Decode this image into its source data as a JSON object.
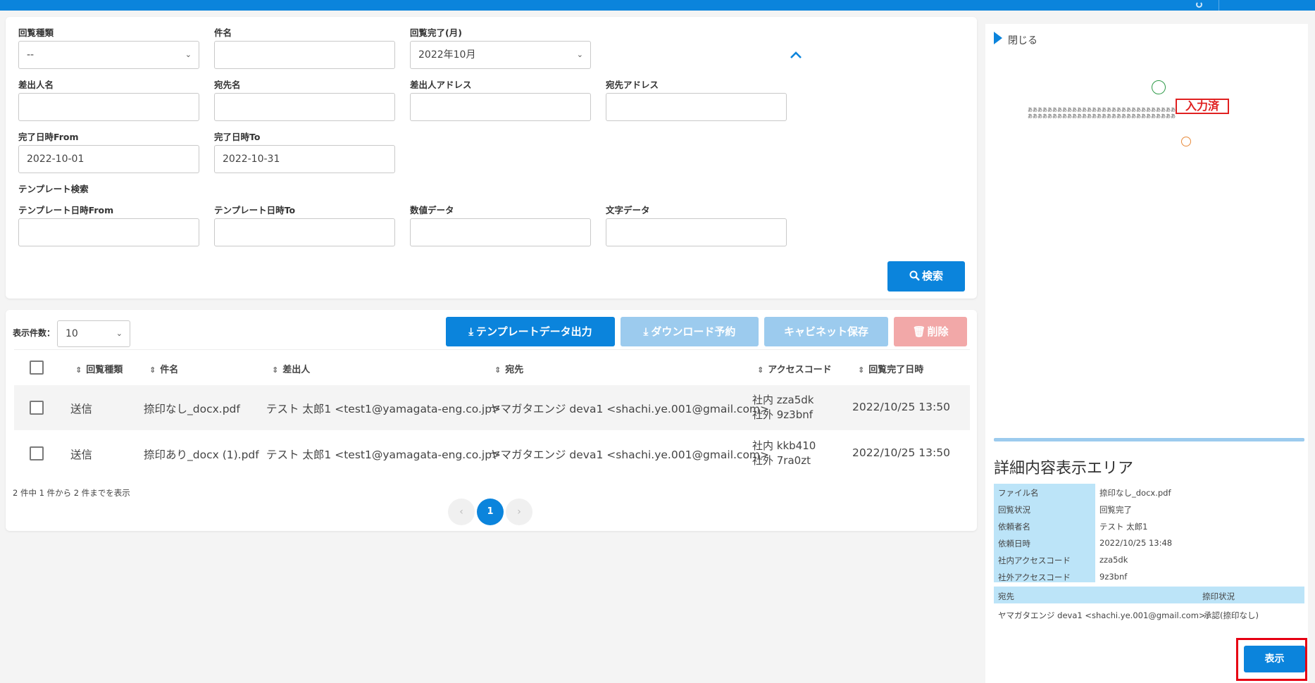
{
  "topbar": {},
  "search": {
    "kind_label": "回覧種類",
    "kind_value": "--",
    "subject_label": "件名",
    "subject_value": "",
    "month_label": "回覧完了(月)",
    "month_value": "2022年10月",
    "sender_label": "差出人名",
    "recipient_label": "宛先名",
    "sender_addr_label": "差出人アドレス",
    "recipient_addr_label": "宛先アドレス",
    "from_label": "完了日時From",
    "from_value": "2022-10-01",
    "to_label": "完了日時To",
    "to_value": "2022-10-31",
    "template_section": "テンプレート検索",
    "tpl_from_label": "テンプレート日時From",
    "tpl_to_label": "テンプレート日時To",
    "numeric_label": "数値データ",
    "text_label": "文字データ",
    "search_button": "検索"
  },
  "results": {
    "page_size_label": "表示件数：",
    "page_size_value": "10",
    "export_button": "テンプレートデータ出力",
    "download_button": "ダウンロード予約",
    "cabinet_button": "キャビネット保存",
    "delete_button": "削除",
    "columns": [
      "回覧種類",
      "件名",
      "差出人",
      "宛先",
      "アクセスコード",
      "回覧完了日時"
    ],
    "rows": [
      {
        "kind": "送信",
        "subject": "捺印なし_docx.pdf",
        "sender": "テスト 太郎1 <test1@yamagata-eng.co.jp>",
        "recipient": "ヤマガタエンジ deva1 <shachi.ye.001@gmail.com>",
        "code_in": "社内 zza5dk",
        "code_out": "社外 9z3bnf",
        "completed": "2022/10/25 13:50"
      },
      {
        "kind": "送信",
        "subject": "捺印あり_docx (1).pdf",
        "sender": "テスト 太郎1 <test1@yamagata-eng.co.jp>",
        "recipient": "ヤマガタエンジ deva1 <shachi.ye.001@gmail.com>",
        "code_in": "社内 kkb410",
        "code_out": "社外 7ra0zt",
        "completed": "2022/10/25 13:50"
      }
    ],
    "summary": "2 件中 1 件から 2 件までを表示",
    "pager": {
      "prev": "‹",
      "current": "1",
      "next": "›"
    }
  },
  "side": {
    "close_label": "閉じる",
    "preview_stamp": "入力済",
    "preview_text_1": "ああああああああああああああああああああああああああああああああ",
    "preview_text_2": "ああああああああああああああああああああああああああああああ",
    "detail_title": "詳細内容表示エリア",
    "details": [
      {
        "label": "ファイル名",
        "value": "捺印なし_docx.pdf"
      },
      {
        "label": "回覧状況",
        "value": "回覧完了"
      },
      {
        "label": "依頼者名",
        "value": "テスト 太郎1"
      },
      {
        "label": "依頼日時",
        "value": "2022/10/25 13:48"
      },
      {
        "label": "社内アクセスコード",
        "value": "zza5dk"
      },
      {
        "label": "社外アクセスコード",
        "value": "9z3bnf"
      }
    ],
    "dest_header": "宛先",
    "stamp_header": "捺印状況",
    "dest_value": "ヤマガタエンジ deva1 <shachi.ye.001@gmail.com>",
    "stamp_value": "承認(捺印なし)",
    "show_button": "表示"
  },
  "colors": {
    "primary": "#0b84dc",
    "highlight_box": "#e60012",
    "detail_label_bg": "#bce4f8"
  }
}
